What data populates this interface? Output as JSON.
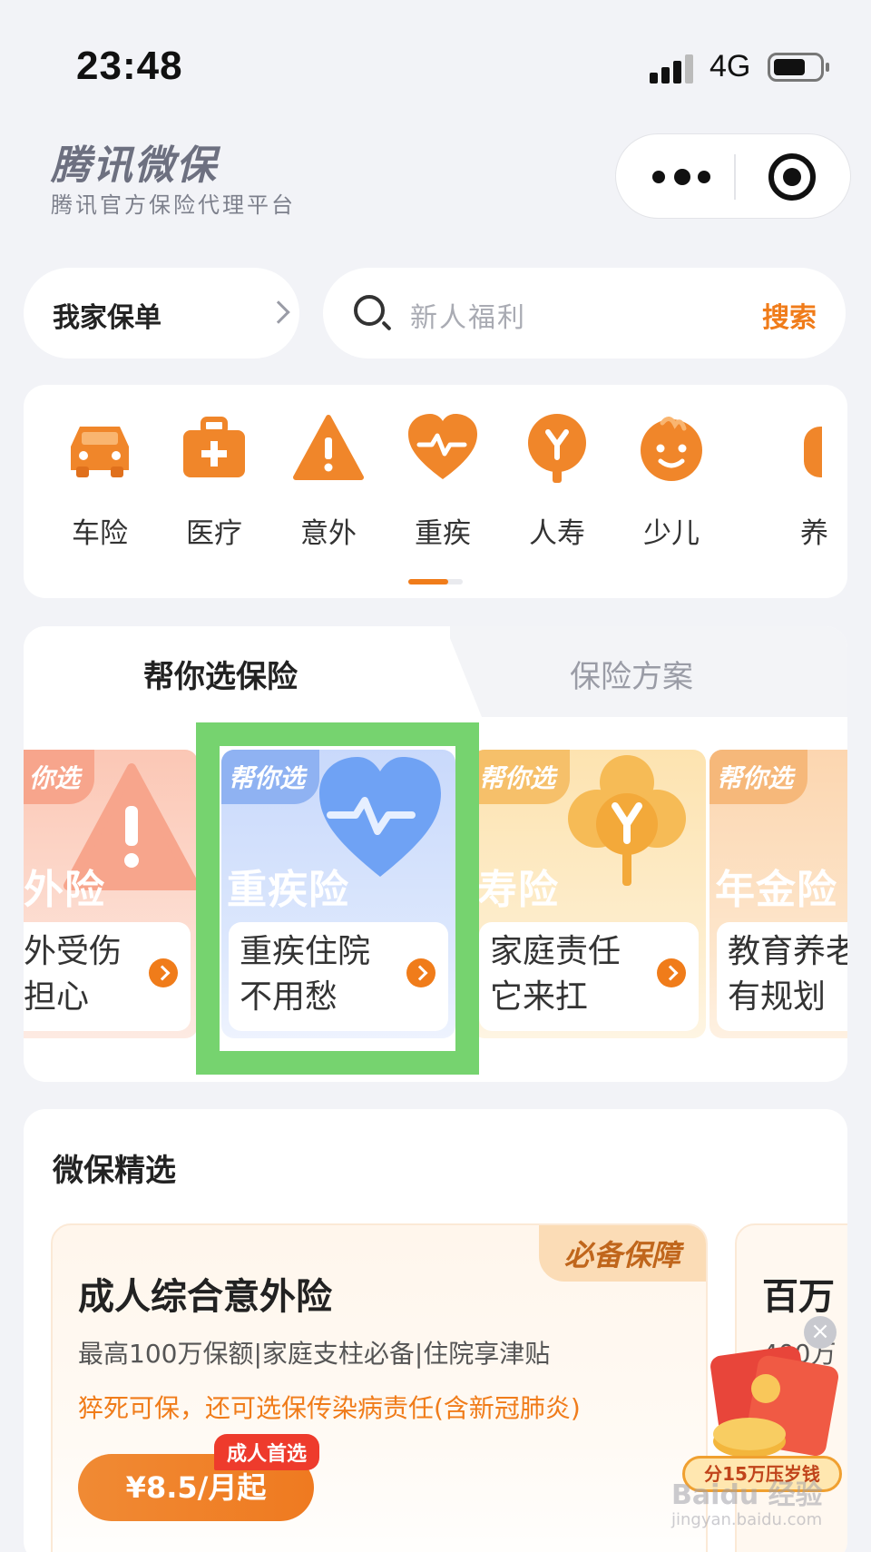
{
  "status": {
    "time": "23:48",
    "network": "4G"
  },
  "brand": {
    "title": "腾讯微保",
    "subtitle": "腾讯官方保险代理平台"
  },
  "policy": {
    "label": "我家保单"
  },
  "search": {
    "placeholder": "新人福利",
    "button": "搜索"
  },
  "categories": [
    {
      "label": "车险",
      "icon": "car-icon"
    },
    {
      "label": "医疗",
      "icon": "medical-kit-icon"
    },
    {
      "label": "意外",
      "icon": "warning-icon"
    },
    {
      "label": "重疾",
      "icon": "heart-pulse-icon"
    },
    {
      "label": "人寿",
      "icon": "tree-icon"
    },
    {
      "label": "少儿",
      "icon": "baby-face-icon"
    },
    {
      "label": "养",
      "icon": "partial-icon"
    }
  ],
  "helper": {
    "tabs": [
      {
        "label": "帮你选保险"
      },
      {
        "label": "保险方案"
      }
    ],
    "cards": [
      {
        "tag": "你选",
        "name": "外险",
        "desc": "外受伤\n担心"
      },
      {
        "tag": "帮你选",
        "name": "重疾险",
        "desc": "重疾住院\n不用愁"
      },
      {
        "tag": "帮你选",
        "name": "寿险",
        "desc": "家庭责任\n它来扛"
      },
      {
        "tag": "帮你选",
        "name": "年金险",
        "desc": "教育养老\n有规划"
      }
    ]
  },
  "featured": {
    "title": "微保精选",
    "product": {
      "badge": "必备保障",
      "name": "成人综合意外险",
      "desc": "最高100万保额|家庭支柱必备|住院享津贴",
      "highlight": "猝死可保，还可选保传染病责任(含新冠肺炎)",
      "price": "¥8.5/月起",
      "price_badge": "成人首选"
    },
    "product2": {
      "name": "百万",
      "desc": "400万"
    }
  },
  "promo": {
    "text": "分15万压岁钱",
    "close": "×"
  },
  "watermark": {
    "line1": "Baidu 经验",
    "line2": "jingyan.baidu.com"
  },
  "colors": {
    "accent": "#f07c1a",
    "highlight_box": "#76d36f"
  }
}
